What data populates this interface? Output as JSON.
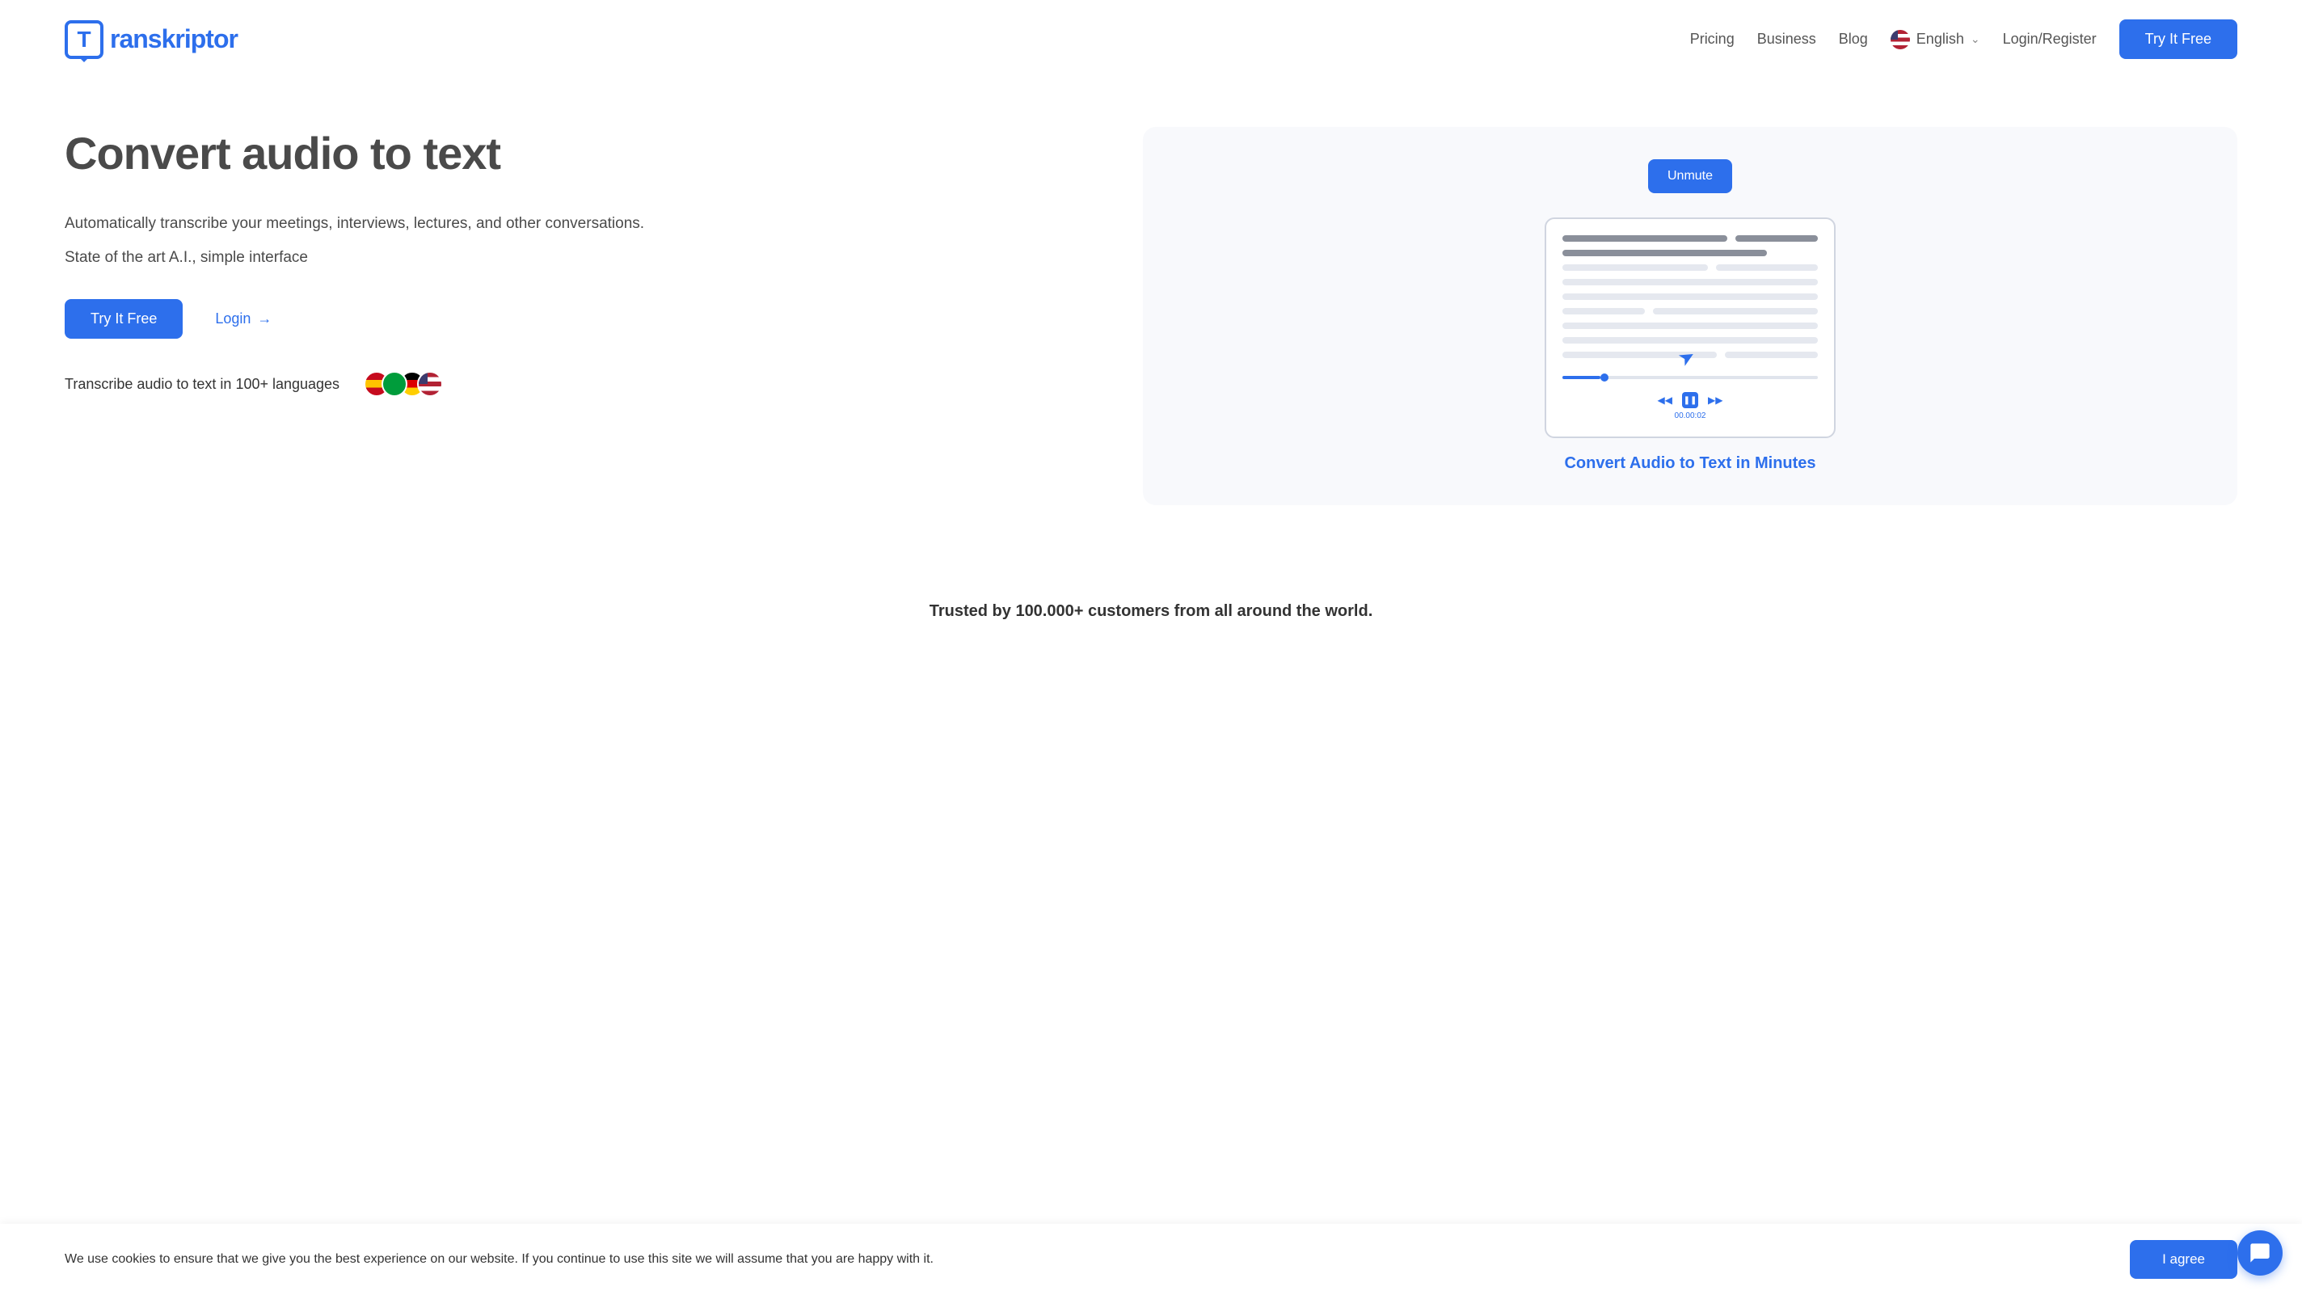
{
  "logo": {
    "text": "ranskriptor",
    "icon_letter": "T"
  },
  "nav": {
    "pricing": "Pricing",
    "business": "Business",
    "blog": "Blog",
    "language": "English",
    "login_register": "Login/Register",
    "try_free": "Try It Free"
  },
  "hero": {
    "title": "Convert audio to text",
    "description": "Automatically transcribe your meetings, interviews, lectures, and other conversations.",
    "description2": "State of the art A.I., simple interface",
    "cta_try": "Try It Free",
    "cta_login": "Login",
    "lang_text": "Transcribe audio to text in 100+ languages"
  },
  "video": {
    "unmute": "Unmute",
    "caption": "Convert Audio to Text in Minutes",
    "player_time": "00.00:02"
  },
  "trust": {
    "text": "Trusted by 100.000+ customers from all around the world."
  },
  "cookie": {
    "text": "We use cookies to ensure that we give you the best experience on our website. If you continue to use this site we will assume that you are happy with it.",
    "agree": "I agree"
  }
}
